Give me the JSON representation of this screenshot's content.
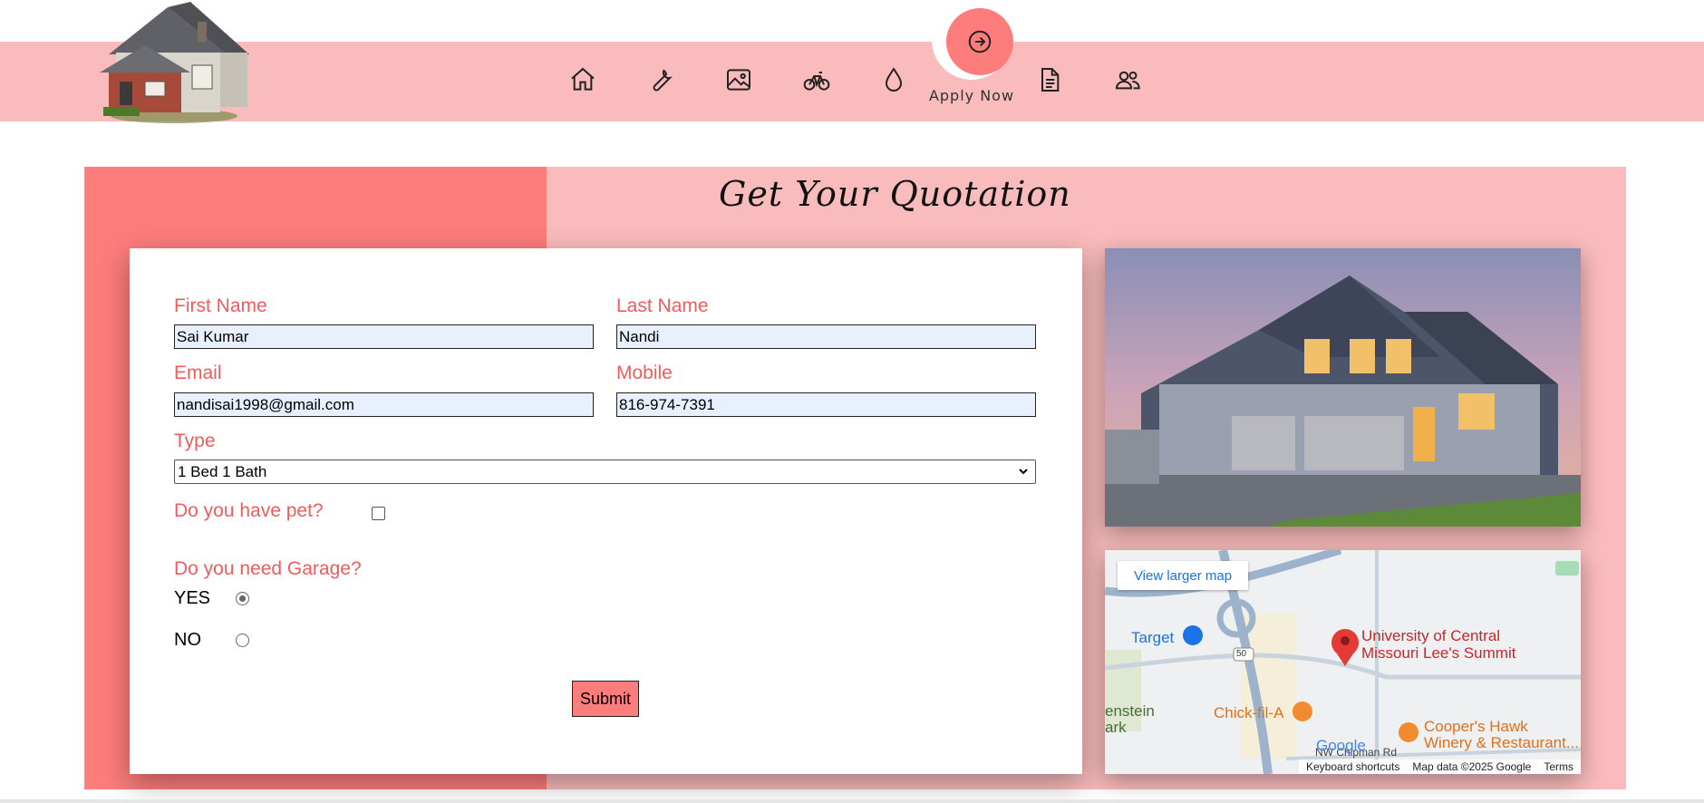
{
  "header": {
    "nav_items": [
      {
        "name": "home-icon"
      },
      {
        "name": "wrench-icon"
      },
      {
        "name": "image-icon"
      },
      {
        "name": "bicycle-icon"
      },
      {
        "name": "droplet-icon"
      },
      {
        "name": "document-icon"
      },
      {
        "name": "people-icon"
      }
    ],
    "apply_label": "Apply Now",
    "accent": "#fd7c7c",
    "band_color": "#f9bbbb"
  },
  "section": {
    "title": "Get Your Quotation"
  },
  "form": {
    "first_name_label": "First Name",
    "first_name_value": "Sai Kumar",
    "last_name_label": "Last Name",
    "last_name_value": "Nandi",
    "email_label": "Email",
    "email_value": "nandisai1998@gmail.com",
    "mobile_label": "Mobile",
    "mobile_value": "816-974-7391",
    "type_label": "Type",
    "type_value": "1 Bed 1 Bath",
    "pet_label": "Do you have pet?",
    "pet_checked": false,
    "garage_label": "Do you need Garage?",
    "garage_yes": "YES",
    "garage_no": "NO",
    "garage_selected": "YES",
    "submit_label": "Submit"
  },
  "map": {
    "larger_map": "View larger map",
    "labels": {
      "target": "Target",
      "university_1": "University of Central",
      "university_2": "Missouri Lee's Summit",
      "chickfila": "Chick-fil-A",
      "coopers_1": "Cooper's Hawk",
      "coopers_2": "Winery & Restaurant...",
      "route": "50",
      "left_1": "enstein",
      "left_2": "ark",
      "road": "NW Chipman Rd",
      "google": "Google"
    },
    "footer": {
      "shortcuts": "Keyboard shortcuts",
      "data": "Map data ©2025 Google",
      "terms": "Terms"
    }
  }
}
